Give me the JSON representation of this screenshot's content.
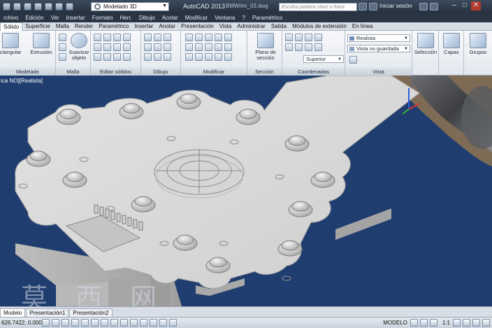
{
  "titlebar": {
    "workspace": "Modelado 3D",
    "app_title": "AutoCAD 2013",
    "file_name": "BMWrim_03.dwg",
    "search_placeholder": "Escriba palabra clave o frase",
    "signin": "Iniciar sesión"
  },
  "menu": [
    "rchivo",
    "Edición",
    "Ver",
    "Insertar",
    "Formato",
    "Herr.",
    "Dibujo",
    "Acotar",
    "Modificar",
    "Ventana",
    "?",
    "Paramétrico"
  ],
  "tabs": [
    "Sólido",
    "Superficie",
    "Malla",
    "Render",
    "Paramétrico",
    "Insertar",
    "Anotar",
    "Presentación",
    "Vista",
    "Administrar",
    "Salida",
    "Módulos de extensión",
    "En línea"
  ],
  "ribbon": {
    "rect_label": "ctangular",
    "extrude_label": "Extrusión",
    "smooth_label": "Suavizar objeto",
    "section_plane_label": "Plano de sección",
    "selection_label": "Selección",
    "layers_label": "Capas",
    "groups_label": "Grupos",
    "visual_style": "Realista",
    "view_saved": "Vista no guardada",
    "ucs_view": "Superior",
    "panels": [
      "Modelado",
      "Malla",
      "Editar sólidos",
      "Dibujo",
      "Modificar",
      "Sección",
      "Coordenadas",
      "Vista"
    ]
  },
  "viewport": {
    "label": "ica NO][Realista]"
  },
  "layout_tabs": [
    "Modelo",
    "Presentación1",
    "Presentación2"
  ],
  "status": {
    "coords": "626.7422, 0.0000",
    "model": "MODELO",
    "scale": "1:1"
  },
  "watermark": "莫 西 网",
  "colors": {
    "viewport_bg": "#1f3d6e",
    "ribbon_bg": "#eef1f5",
    "title_bg": "#2f3b4b"
  }
}
